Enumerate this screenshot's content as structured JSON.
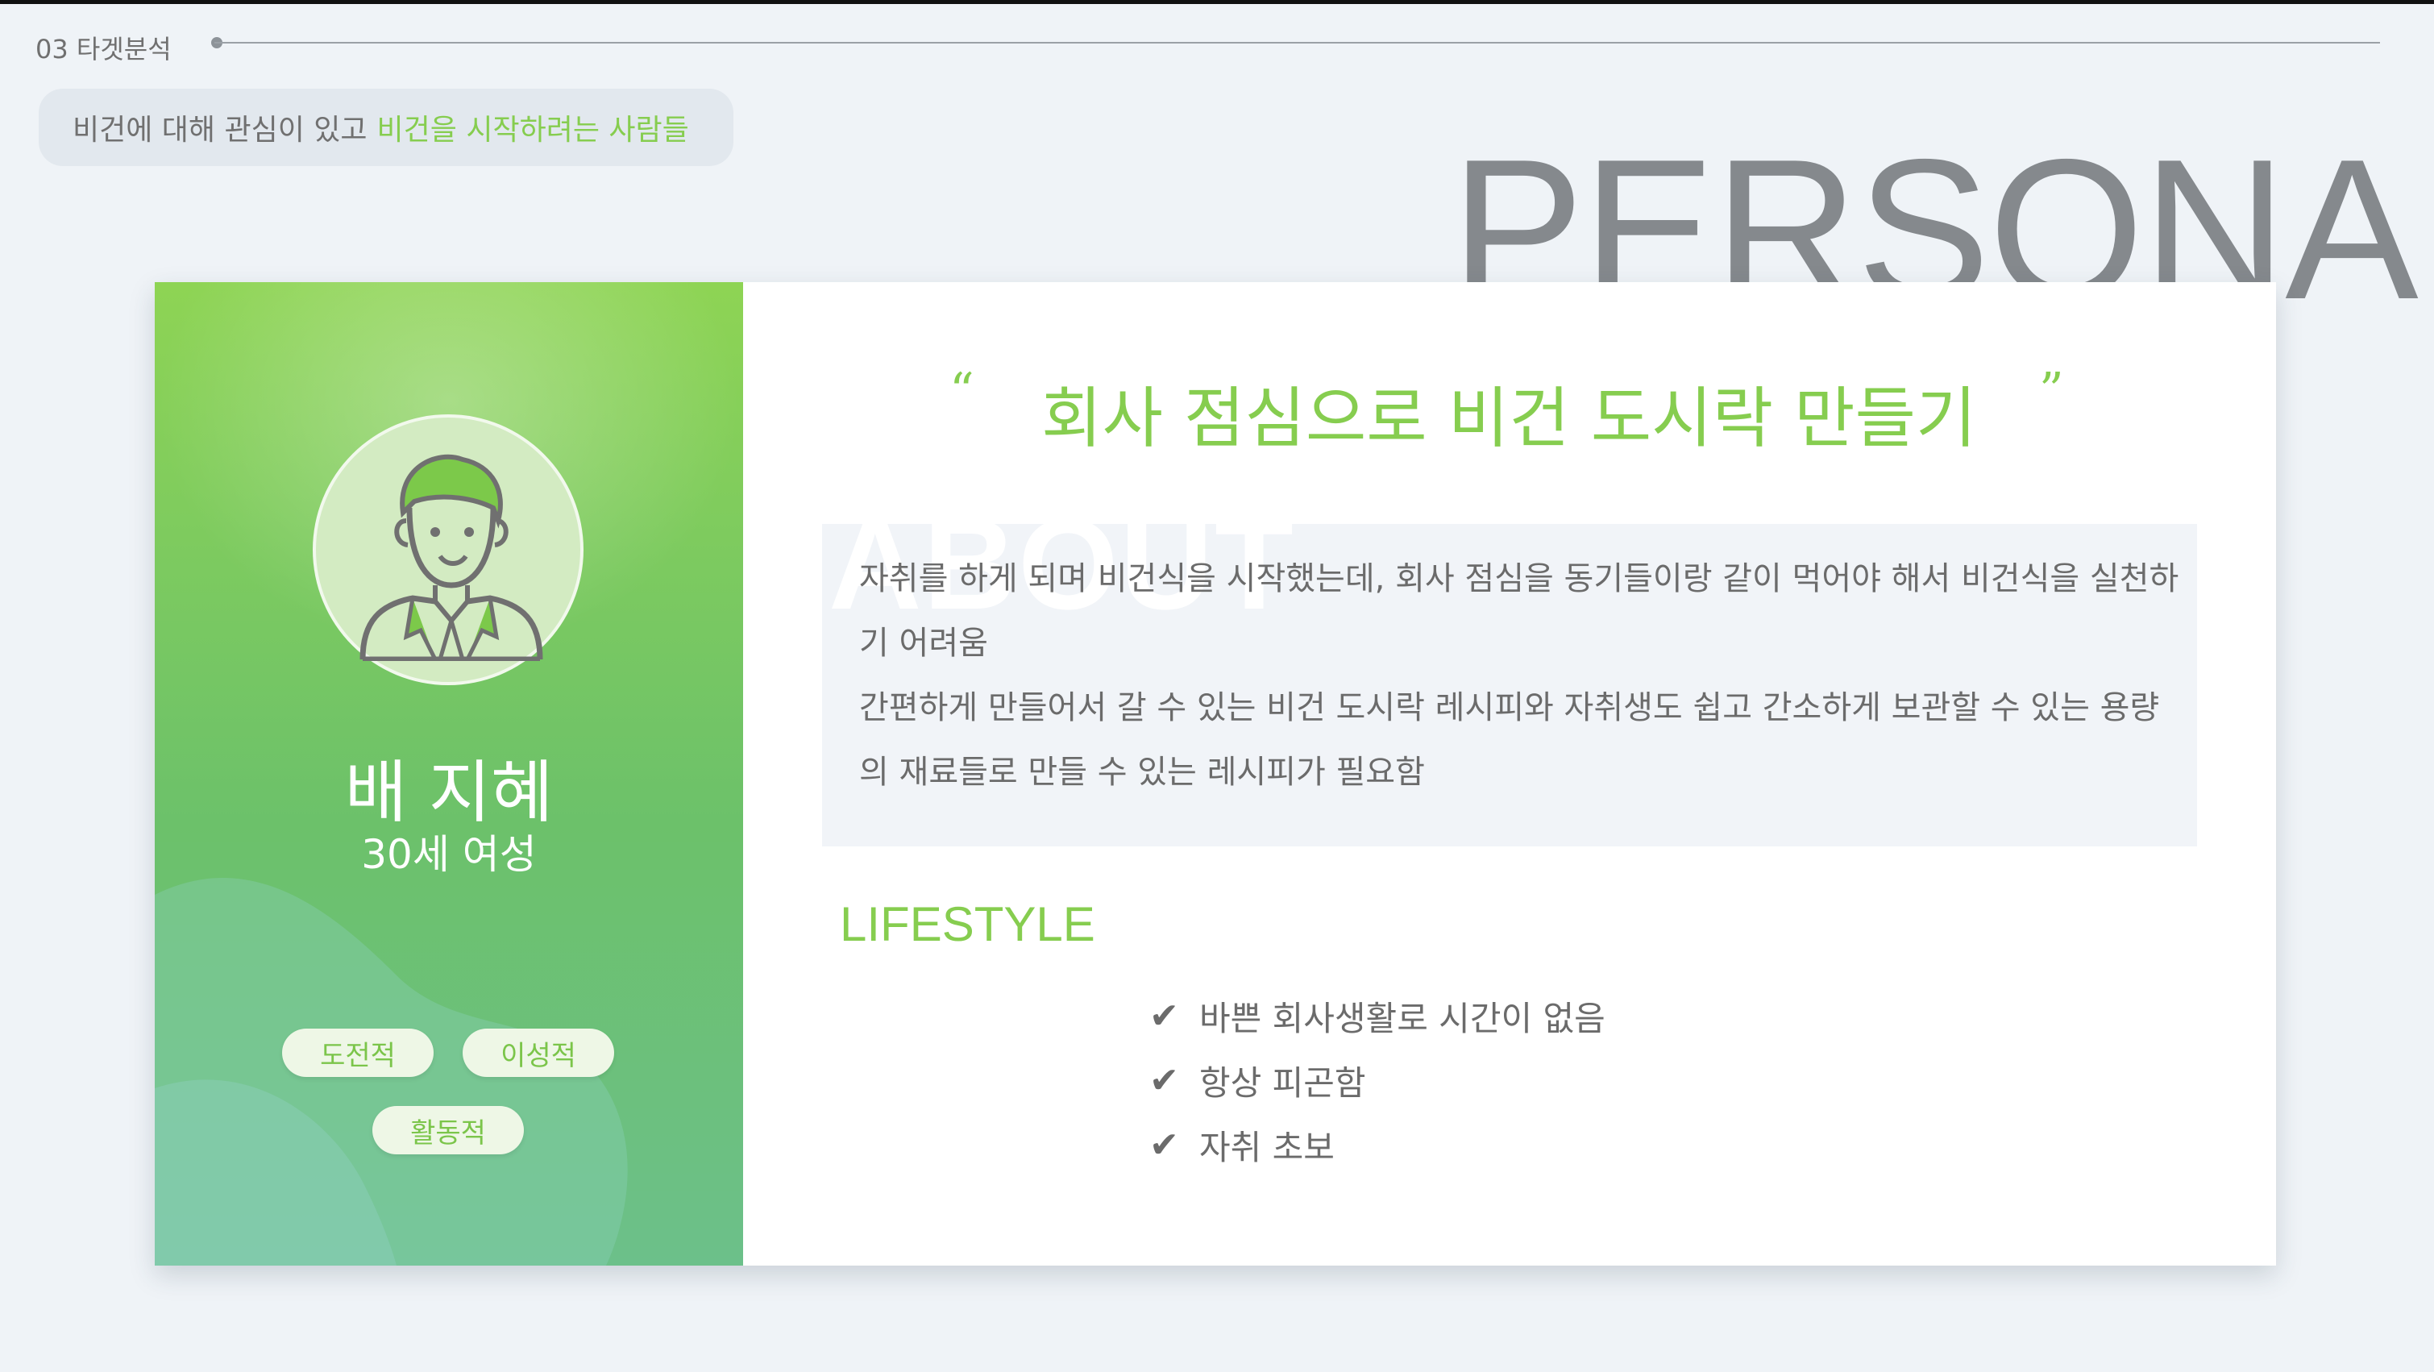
{
  "header": {
    "section_label": "03 타겟분석",
    "subtitle_prefix": "비건에 대해 관심이 있고",
    "subtitle_highlight": "비건을 시작하려는 사람들"
  },
  "big_title": "PERSONA",
  "persona": {
    "name": "배 지혜",
    "meta": "30세 여성",
    "tags": [
      "도전적",
      "이성적",
      "활동적"
    ]
  },
  "quote": {
    "open": "“",
    "text": "회사 점심으로 비건 도시락 만들기",
    "close": "”"
  },
  "about": {
    "watermark": "ABOUT",
    "lines": [
      "자취를 하게 되며 비건식을 시작했는데, 회사 점심을 동기들이랑 같이 먹어야 해서 비건식을 실천하기 어려움",
      "간편하게 만들어서 갈 수 있는 비건 도시락 레시피와 자취생도 쉽고 간소하게 보관할 수 있는 용량의 재료들로 만들 수 있는 레시피가 필요함"
    ]
  },
  "lifestyle": {
    "title": "LIFESTYLE",
    "check_symbol": "✔",
    "items": [
      "바쁜 회사생활로 시간이 없음",
      "항상 피곤함",
      "자취 초보"
    ]
  },
  "colors": {
    "accent": "#86cd4f",
    "text": "#6b6b6b",
    "background": "#eff3f7"
  },
  "icons": {
    "avatar": "person-avatar-icon",
    "check": "check-icon"
  }
}
